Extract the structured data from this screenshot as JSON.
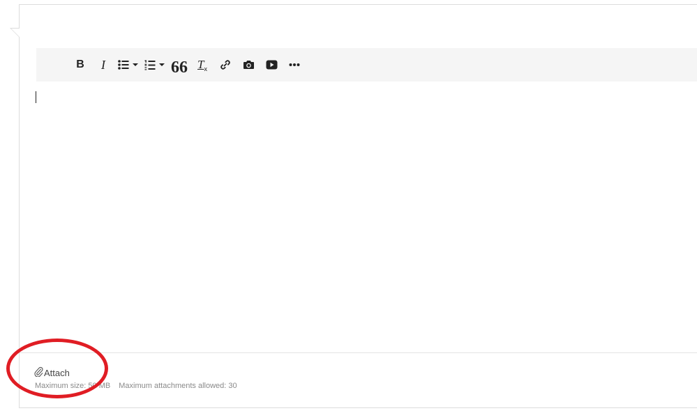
{
  "toolbar": {
    "bold_glyph": "B",
    "italic_glyph": "I",
    "quote_glyph": "66",
    "clear_format_glyph": "T",
    "clear_format_sub": "x",
    "buttons": [
      {
        "name": "bold",
        "icon": "bold-icon"
      },
      {
        "name": "italic",
        "icon": "italic-icon"
      },
      {
        "name": "bulleted-list",
        "icon": "bulleted-list-icon",
        "has_dropdown": true
      },
      {
        "name": "numbered-list",
        "icon": "numbered-list-icon",
        "has_dropdown": true
      },
      {
        "name": "blockquote",
        "icon": "quote-icon"
      },
      {
        "name": "remove-format",
        "icon": "clear-formatting-icon"
      },
      {
        "name": "insert-link",
        "icon": "link-icon"
      },
      {
        "name": "insert-image",
        "icon": "camera-icon"
      },
      {
        "name": "insert-video",
        "icon": "youtube-play-icon"
      },
      {
        "name": "more",
        "icon": "more-horizontal-icon"
      }
    ]
  },
  "editor": {
    "content": ""
  },
  "attachments": {
    "attach_label": "Attach",
    "max_size_label": "Maximum size: 50 MB",
    "max_attachments_label": "Maximum attachments allowed: 30"
  },
  "annotation": {
    "circle_color": "#e01d24"
  },
  "colors": {
    "toolbar_bg": "#f5f5f5",
    "border": "#dcdcdc",
    "meta_text": "#8a8a8a"
  }
}
